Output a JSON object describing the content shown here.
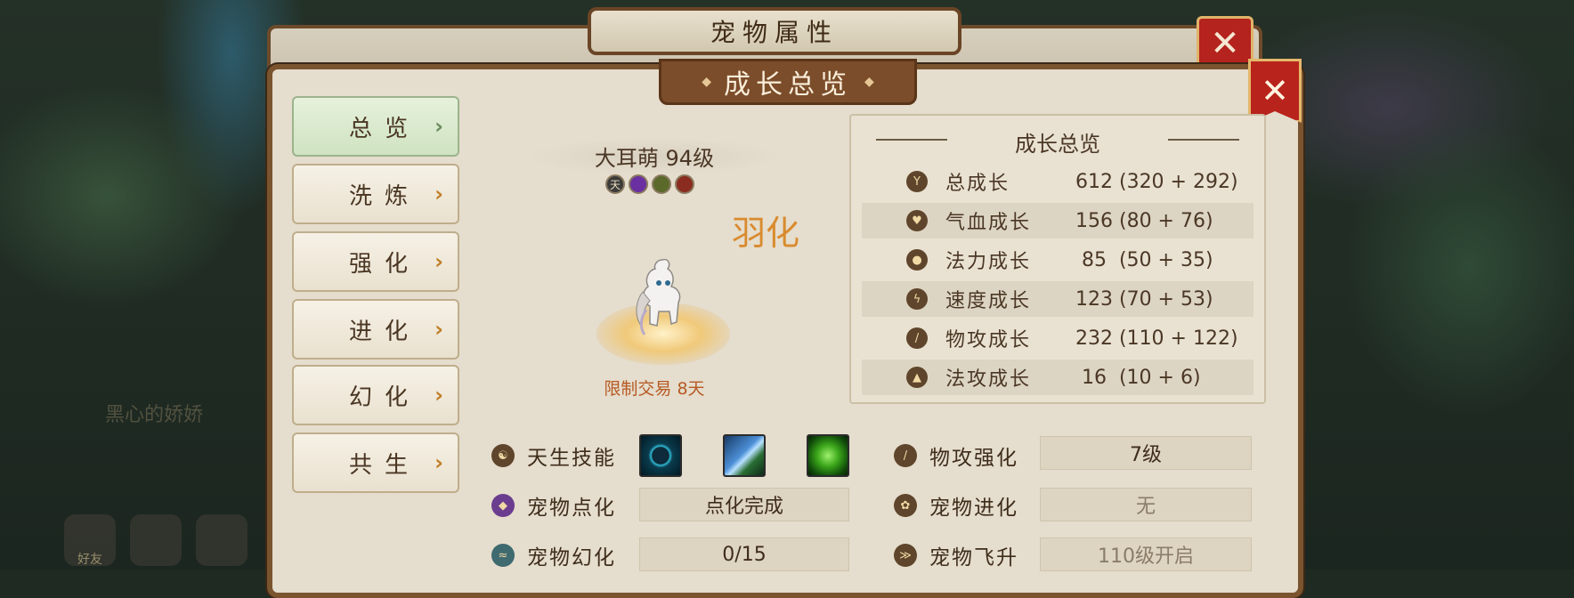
{
  "background": {
    "faded_text": "黑心的娇娇",
    "bottom_icons": [
      {
        "name": "friends-icon",
        "label": "好友"
      },
      {
        "name": "chat-icon",
        "label": ""
      },
      {
        "name": "voice-icon",
        "label": ""
      }
    ]
  },
  "back_window": {
    "title": "宠物属性",
    "close_label": "✕"
  },
  "window": {
    "title": "成长总览",
    "close_label": "✕"
  },
  "sidebar": {
    "items": [
      {
        "label": "总览",
        "active": true
      },
      {
        "label": "洗炼",
        "active": false
      },
      {
        "label": "强化",
        "active": false
      },
      {
        "label": "进化",
        "active": false
      },
      {
        "label": "幻化",
        "active": false
      },
      {
        "label": "共生",
        "active": false
      }
    ],
    "chevron": "›"
  },
  "pet": {
    "name": "大耳萌 94级",
    "badges": [
      {
        "name": "innate-badge",
        "glyph": "天"
      },
      {
        "name": "enchant-badge",
        "glyph": ""
      },
      {
        "name": "illusion-badge",
        "glyph": ""
      },
      {
        "name": "crown-badge",
        "glyph": ""
      }
    ],
    "mark": "羽化",
    "trade_limit": "限制交易 8天"
  },
  "growth": {
    "title": "成长总览",
    "rows": [
      {
        "icon": "total-growth-icon",
        "label": "总成长",
        "value": "612 (320 + 292)"
      },
      {
        "icon": "hp-growth-icon",
        "label": "气血成长",
        "value": "156 (80 + 76)"
      },
      {
        "icon": "mana-growth-icon",
        "label": "法力成长",
        "value": " 85  (50 + 35)"
      },
      {
        "icon": "speed-growth-icon",
        "label": "速度成长",
        "value": "123 (70 + 53)"
      },
      {
        "icon": "phys-attack-growth-icon",
        "label": "物攻成长",
        "value": "232 (110 + 122)"
      },
      {
        "icon": "magic-attack-growth-icon",
        "label": "法攻成长",
        "value": " 16  (10 + 6)"
      }
    ]
  },
  "attributes_left": {
    "innate_skill_label": "天生技能",
    "skills": [
      "ring-skill-icon",
      "blade-skill-icon",
      "poison-skill-icon"
    ],
    "enchant_label": "宠物点化",
    "enchant_value": "点化完成",
    "illusion_label": "宠物幻化",
    "illusion_value": "0/15"
  },
  "attributes_right": {
    "phys_enhance_label": "物攻强化",
    "phys_enhance_value": "7级",
    "evolve_label": "宠物进化",
    "evolve_value": "无",
    "ascend_label": "宠物飞升",
    "ascend_value": "110级开启"
  },
  "colors": {
    "panel_bg": "#e5ddcd",
    "frame": "#7a542f",
    "close_red": "#b8231c",
    "accent_orange": "#c07e27",
    "trade_text": "#b65a24"
  }
}
